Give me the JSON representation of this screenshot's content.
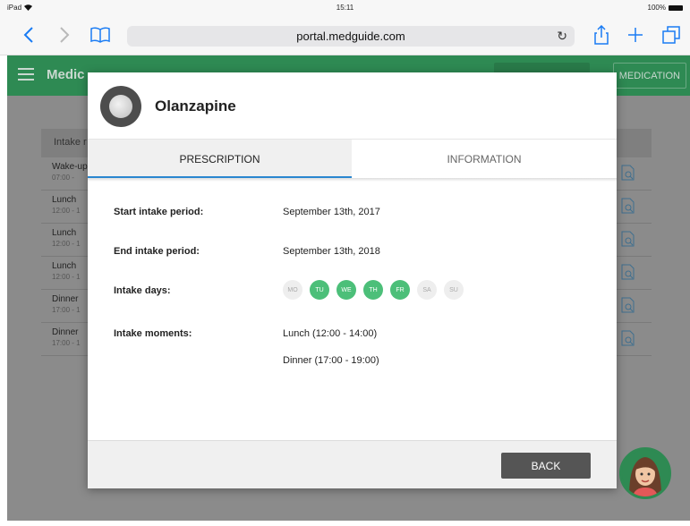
{
  "status_bar": {
    "device": "iPad",
    "time": "15:11",
    "battery": "100%"
  },
  "browser": {
    "url": "portal.medguide.com"
  },
  "app": {
    "title_partial": "Medic",
    "add_medication_label": "MEDICATION",
    "brand_color": "#2e8a53"
  },
  "background_table": {
    "header_partial": "Intake r",
    "rows": [
      {
        "label": "Wake-up",
        "time": "07:00 - "
      },
      {
        "label": "Lunch",
        "time": "12:00 - 1"
      },
      {
        "label": "Lunch",
        "time": "12:00 - 1"
      },
      {
        "label": "Lunch",
        "time": "12:00 - 1"
      },
      {
        "label": "Dinner",
        "time": "17:00 - 1"
      },
      {
        "label": "Dinner",
        "time": "17:00 - 1"
      }
    ]
  },
  "modal": {
    "medication_name": "Olanzapine",
    "tabs": [
      {
        "label": "PRESCRIPTION",
        "active": true
      },
      {
        "label": "INFORMATION",
        "active": false
      }
    ],
    "fields": {
      "start_label": "Start intake period:",
      "start_value": "September 13th, 2017",
      "end_label": "End intake period:",
      "end_value": "September 13th, 2018",
      "days_label": "Intake days:",
      "moments_label": "Intake moments:",
      "moments": [
        "Lunch (12:00 - 14:00)",
        "Dinner (17:00 - 19:00)"
      ]
    },
    "days": [
      {
        "label": "MO",
        "active": false
      },
      {
        "label": "TU",
        "active": true
      },
      {
        "label": "WE",
        "active": true
      },
      {
        "label": "TH",
        "active": true
      },
      {
        "label": "FR",
        "active": true
      },
      {
        "label": "SA",
        "active": false
      },
      {
        "label": "SU",
        "active": false
      }
    ],
    "back_label": "BACK",
    "colors": {
      "active_tab_ink": "#2a87d0",
      "day_active": "#4cbf79",
      "back_button": "#555555"
    }
  }
}
